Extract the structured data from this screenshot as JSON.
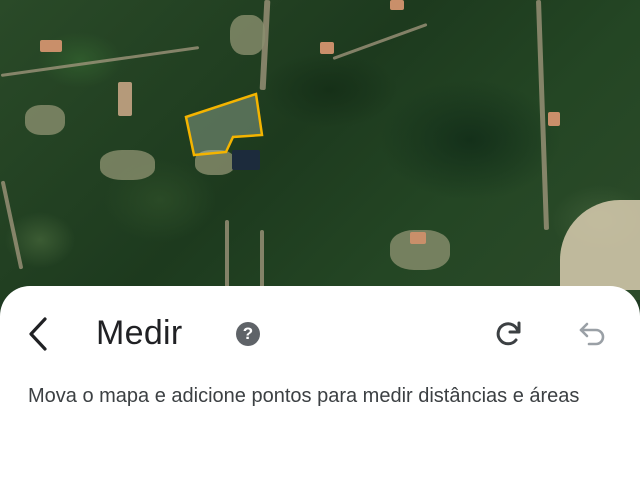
{
  "map": {
    "view": "satellite",
    "measured_area_outline_color": "#f4b400"
  },
  "measure_panel": {
    "title": "Medir",
    "back_icon": "chevron-left-icon",
    "help_icon": "help-circle-icon",
    "help_glyph": "?",
    "redo_icon": "redo-icon",
    "undo_icon": "undo-icon",
    "undo_enabled": false,
    "instructions": "Mova o mapa e adicione pontos para medir distâncias e áreas"
  }
}
